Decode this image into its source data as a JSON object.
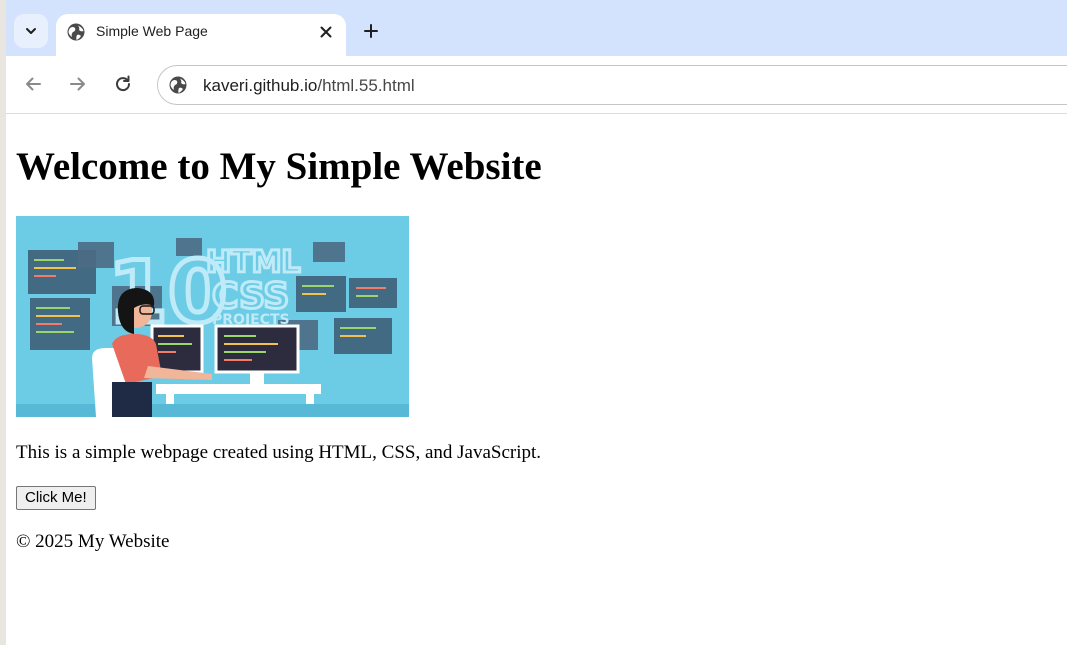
{
  "browser": {
    "tab": {
      "title": "Simple Web Page",
      "favicon": "globe-icon"
    },
    "address_bar": {
      "host": "kaveri.github.io",
      "path": "/html.55.html"
    },
    "icons": {
      "tab_list": "chevron-down-icon",
      "close": "close-icon",
      "new_tab": "plus-icon",
      "back": "back-arrow-icon",
      "forward": "forward-arrow-icon",
      "reload": "reload-icon",
      "site_info": "site-info-icon"
    },
    "colors": {
      "tabstrip": "#d3e3fd",
      "active_tab": "#ffffff"
    }
  },
  "page": {
    "heading": "Welcome to My Simple Website",
    "hero_image": {
      "big_number": "10",
      "line1": "HTML",
      "line2": "CSS",
      "line3": "PROJECTS",
      "background": "#6ccbe5"
    },
    "intro": "This is a simple webpage created using HTML, CSS, and JavaScript.",
    "button_label": "Click Me!",
    "footer": "© 2025 My Website"
  }
}
